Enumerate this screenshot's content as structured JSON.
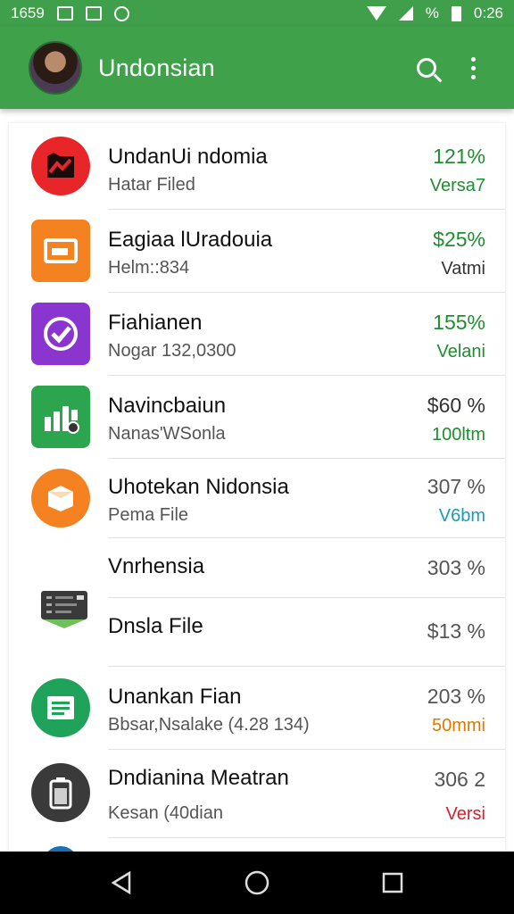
{
  "status_bar": {
    "time_left": "1659",
    "battery_text": "%",
    "time_right": "0:26"
  },
  "app_bar": {
    "title": "Undonsian",
    "color": "#3fa24b"
  },
  "items": [
    {
      "title": "UndanUi ndomia",
      "subtitle": "Hatar Filed",
      "value": "121%",
      "value_color": "#1e8f2e",
      "tag": "Versa7",
      "tag_color": "#1e8f2e",
      "icon": "flag-icon",
      "icon_bg": "#e8262a"
    },
    {
      "title": "Eagiaa lUradouia",
      "subtitle": "Helm::834",
      "value": "$25%",
      "value_color": "#1e8f2e",
      "tag": "Vatmi",
      "tag_color": "#333333",
      "icon": "picture-icon",
      "icon_bg": "#f58220"
    },
    {
      "title": "Fiahianen",
      "subtitle": "Nogar 132,0300",
      "value": "155%",
      "value_color": "#1e8f2e",
      "tag": "Velani",
      "tag_color": "#1e8f2e",
      "icon": "check-icon",
      "icon_bg": "#8a35d0"
    },
    {
      "title": "Navincbaiun",
      "subtitle": "Nanas'WSonla",
      "value": "$60 %",
      "value_color": "#333333",
      "tag": "100ltm",
      "tag_color": "#1e8f2e",
      "icon": "bar-chart-icon",
      "icon_bg": "#2da44e"
    },
    {
      "title": "Uhotekan Nidonsia",
      "subtitle": "Pema File",
      "value": "307 %",
      "value_color": "#555555",
      "tag": "V6bm",
      "tag_color": "#1a9bb5",
      "icon": "box-icon",
      "icon_bg": "#f58220"
    },
    {
      "title": "Vnrhensia",
      "subtitle": "",
      "value": "303 %",
      "value_color": "#555555",
      "tag": "",
      "tag_color": "#555555",
      "icon": "",
      "icon_bg": ""
    },
    {
      "title": "Dnsla File",
      "subtitle": "",
      "value": "$13 %",
      "value_color": "#555555",
      "tag": "",
      "tag_color": "#555555",
      "icon": "server-icon",
      "icon_bg": "#3a3a3a"
    },
    {
      "title": "Unankan Fian",
      "subtitle": "Bbsar,Nsalake (4.28 134)",
      "value": "203 %",
      "value_color": "#555555",
      "tag": "50mmi",
      "tag_color": "#e07800",
      "icon": "document-icon",
      "icon_bg": "#1fa35a"
    },
    {
      "title": "Dndianina Meatran",
      "subtitle": "Kesan (40dian",
      "value": "306 2",
      "value_color": "#555555",
      "tag": "Versi",
      "tag_color": "#d8202a",
      "icon": "phone-icon",
      "icon_bg": "#3a3a3a"
    }
  ]
}
